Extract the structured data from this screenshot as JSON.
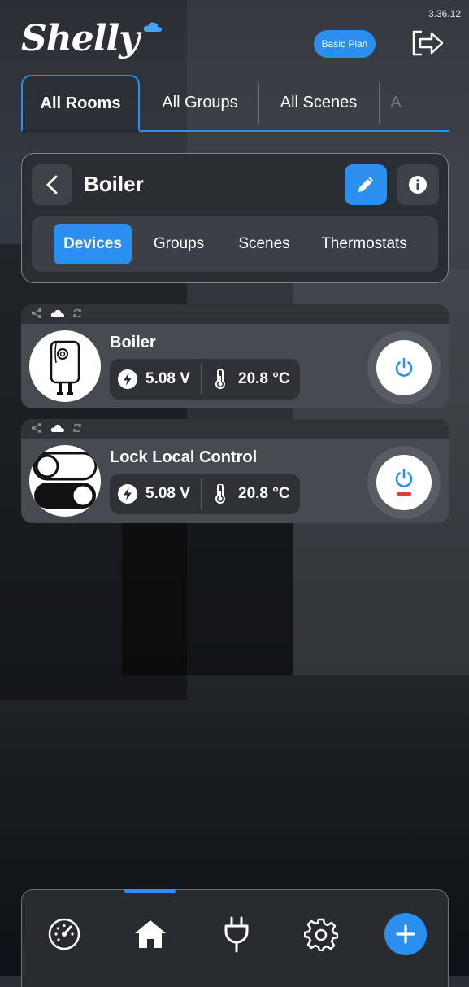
{
  "app": {
    "version": "3.36.12",
    "logo_text": "Shelly",
    "plan_badge": "Basic Plan"
  },
  "tabs": [
    {
      "label": "All Rooms",
      "active": true
    },
    {
      "label": "All Groups",
      "active": false
    },
    {
      "label": "All Scenes",
      "active": false
    },
    {
      "label": "A",
      "active": false
    }
  ],
  "room": {
    "title": "Boiler",
    "subtabs": [
      {
        "label": "Devices",
        "active": true
      },
      {
        "label": "Groups",
        "active": false
      },
      {
        "label": "Scenes",
        "active": false
      },
      {
        "label": "Thermostats",
        "active": false
      }
    ]
  },
  "devices": [
    {
      "name": "Boiler",
      "voltage": "5.08 V",
      "temperature": "20.8 °C",
      "image_icon": "water-heater-icon",
      "power_state": "off"
    },
    {
      "name": "Lock Local Control",
      "voltage": "5.08 V",
      "temperature": "20.8 °C",
      "image_icon": "toggle-switch-icon",
      "power_state": "off-with-red-indicator"
    }
  ],
  "bottom_nav": [
    {
      "icon": "dashboard-gauge-icon",
      "active": false
    },
    {
      "icon": "home-icon",
      "active": true
    },
    {
      "icon": "plug-icon",
      "active": false
    },
    {
      "icon": "gear-icon",
      "active": false
    },
    {
      "icon": "add-icon",
      "active": false
    }
  ],
  "colors": {
    "accent": "#2b8ff0",
    "power_off_indicator": "#e53935"
  }
}
